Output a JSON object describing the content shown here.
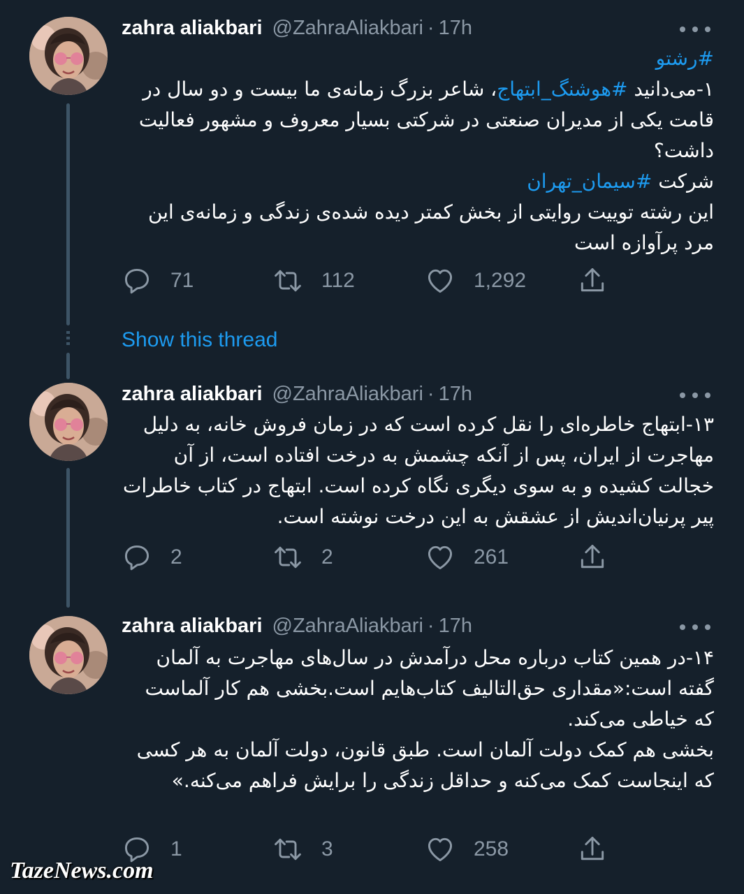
{
  "tweets": [
    {
      "name": "zahra aliakbari",
      "handle": "@ZahraAliakbari",
      "separator": "·",
      "time": "17h",
      "paragraphs": [
        {
          "parts": [
            {
              "text": "#رشتو",
              "tag": true
            }
          ]
        },
        {
          "parts": [
            {
              "text": "۱-می‌دانید ",
              "tag": false
            },
            {
              "text": "#هوشنگ_ابتهاج",
              "tag": true
            },
            {
              "text": "، شاعر بزرگ زمانه‌ی ما بیست و دو سال در قامت یکی از مدیران صنعتی در شرکتی بسیار معروف و مشهور فعالیت داشت؟",
              "tag": false
            }
          ]
        },
        {
          "parts": [
            {
              "text": "شرکت ",
              "tag": false
            },
            {
              "text": "#سیمان_تهران",
              "tag": true
            }
          ]
        },
        {
          "parts": [
            {
              "text": "این رشته توییت روایتی از بخش کمتر دیده شده‌ی زندگی و زمانه‌ی این مرد پرآوازه است",
              "tag": false
            }
          ]
        }
      ],
      "replies": "71",
      "retweets": "112",
      "likes": "1,292"
    },
    {
      "name": "zahra aliakbari",
      "handle": "@ZahraAliakbari",
      "separator": "·",
      "time": "17h",
      "paragraphs": [
        {
          "parts": [
            {
              "text": "۱۳-ابتهاج خاطره‌ای را نقل کرده است که در زمان فروش خانه، به دلیل مهاجرت از ایران، پس از آنکه چشمش به درخت افتاده است، از آن خجالت کشیده و به سوی دیگری نگاه کرده است. ابتهاج در کتاب خاطرات پیر پرنیان‌اندیش از عشقش به این درخت نوشته است.",
              "tag": false
            }
          ]
        }
      ],
      "replies": "2",
      "retweets": "2",
      "likes": "261"
    },
    {
      "name": "zahra aliakbari",
      "handle": "@ZahraAliakbari",
      "separator": "·",
      "time": "17h",
      "paragraphs": [
        {
          "parts": [
            {
              "text": "۱۴-در همین کتاب درباره محل درآمدش در سال‌های مهاجرت به آلمان گفته است:«مقداری حق‌التالیف کتاب‌هایم است.بخشی هم کار آلماست که خیاطی می‌کند.",
              "tag": false
            }
          ]
        },
        {
          "parts": [
            {
              "text": "بخشی هم کمک دولت آلمان است. طبق قانون، دولت آلمان به هر کسی که اینجاست کمک می‌کنه و حداقل زندگی را برایش فراهم می‌کنه.»",
              "tag": false
            }
          ]
        }
      ],
      "replies": "1",
      "retweets": "3",
      "likes": "258"
    }
  ],
  "show_thread": "Show this thread",
  "watermark": "TazeNews.com",
  "colors": {
    "background": "#15202b",
    "secondary_text": "#8b98a5",
    "link": "#1d9bf0",
    "thread_line": "#3d5466"
  },
  "icons": {
    "reply": "reply-icon",
    "retweet": "retweet-icon",
    "like": "like-icon",
    "share": "share-icon",
    "more": "more-icon"
  }
}
